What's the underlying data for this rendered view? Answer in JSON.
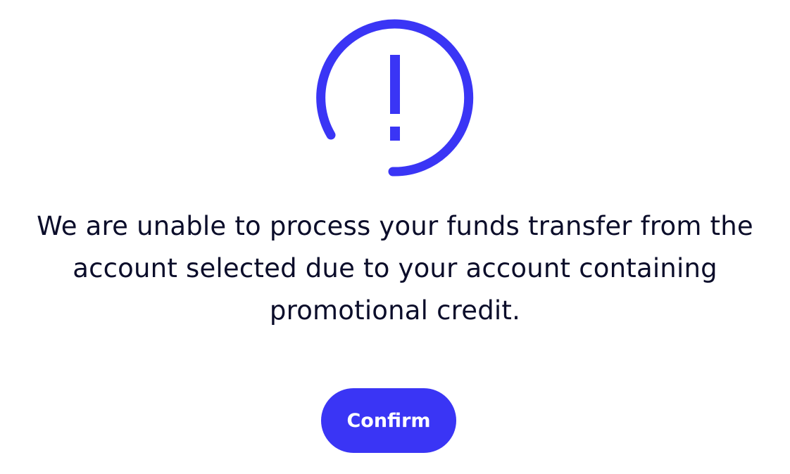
{
  "alert": {
    "icon": "exclamation-circle-icon",
    "color": "#3a35f5"
  },
  "message": {
    "text": "We are unable to process your funds transfer from the account selected due to your account containing promotional credit.",
    "color": "#0b0d2a"
  },
  "confirm_button": {
    "label": "Confirm",
    "background": "#3a35f5",
    "text_color": "#ffffff"
  }
}
